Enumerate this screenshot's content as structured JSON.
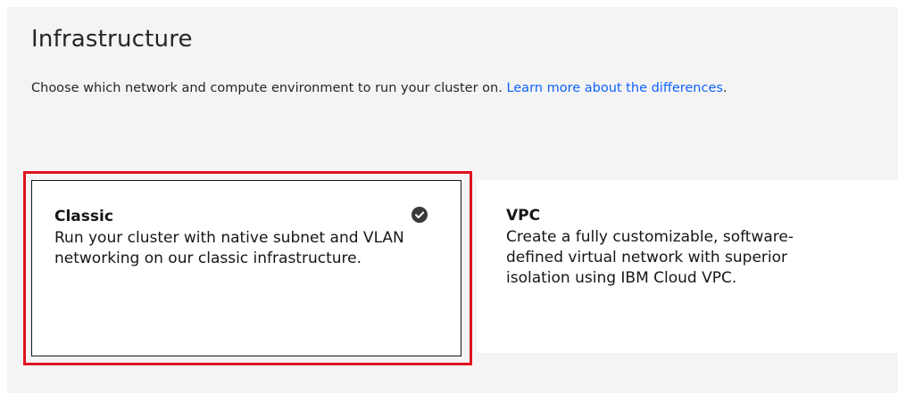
{
  "section": {
    "title": "Infrastructure",
    "description": "Choose which network and compute environment to run your cluster on. ",
    "link_text": "Learn more about the differences",
    "link_suffix": "."
  },
  "options": [
    {
      "title": "Classic",
      "description": "Run your cluster with native subnet and VLAN networking on our classic infrastructure.",
      "selected": true,
      "icon": "checkmark-filled-icon"
    },
    {
      "title": "VPC",
      "description": "Create a fully customizable, software-defined virtual network with superior isolation using IBM Cloud VPC.",
      "selected": false
    }
  ],
  "colors": {
    "link": "#0f62fe",
    "highlight": "#e0121f",
    "panel": "#f4f4f4",
    "tile": "#ffffff"
  }
}
